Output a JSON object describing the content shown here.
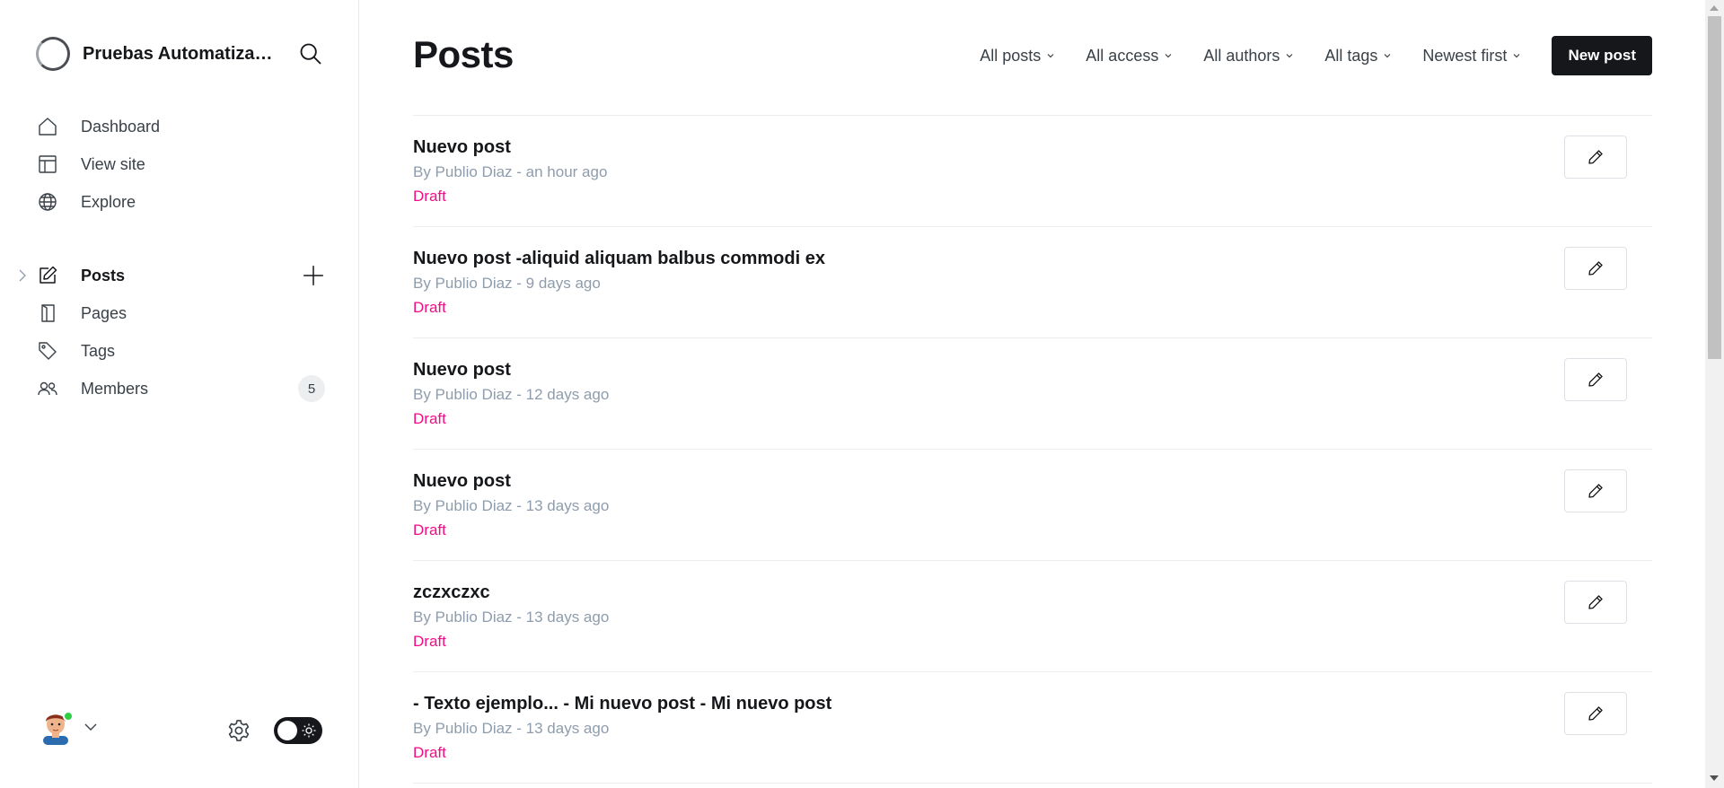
{
  "app": {
    "site_name": "Pruebas Automatizad..."
  },
  "sidebar": {
    "top_items": [
      {
        "label": "Dashboard",
        "icon": "home-icon"
      },
      {
        "label": "View site",
        "icon": "layout-icon"
      },
      {
        "label": "Explore",
        "icon": "globe-icon"
      }
    ],
    "content_items": [
      {
        "label": "Posts",
        "icon": "edit-icon",
        "active": true
      },
      {
        "label": "Pages",
        "icon": "page-icon"
      },
      {
        "label": "Tags",
        "icon": "tag-icon"
      },
      {
        "label": "Members",
        "icon": "members-icon",
        "count": "5"
      }
    ]
  },
  "main": {
    "title": "Posts",
    "filters": [
      "All posts",
      "All access",
      "All authors",
      "All tags",
      "Newest first"
    ],
    "new_post_label": "New post",
    "posts": [
      {
        "title": "Nuevo post",
        "meta": "By Publio Diaz - an hour ago",
        "status": "Draft"
      },
      {
        "title": "Nuevo post -aliquid aliquam balbus commodi ex",
        "meta": "By Publio Diaz - 9 days ago",
        "status": "Draft"
      },
      {
        "title": "Nuevo post",
        "meta": "By Publio Diaz - 12 days ago",
        "status": "Draft"
      },
      {
        "title": "Nuevo post",
        "meta": "By Publio Diaz - 13 days ago",
        "status": "Draft"
      },
      {
        "title": "zczxczxc",
        "meta": "By Publio Diaz - 13 days ago",
        "status": "Draft"
      },
      {
        "title": "- Texto ejemplo... - Mi nuevo post - Mi nuevo post",
        "meta": "By Publio Diaz - 13 days ago",
        "status": "Draft"
      }
    ]
  },
  "colors": {
    "accent_dark": "#15171a",
    "draft": "#f50b86",
    "meta": "#8e9cac",
    "online": "#30cf43"
  }
}
